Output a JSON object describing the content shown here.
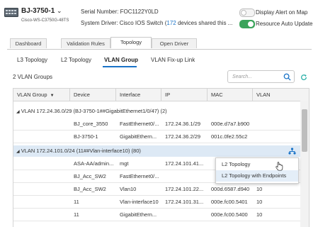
{
  "header": {
    "device_name": "BJ-3750-1",
    "device_model": "Cisco-WS-C3750G-48TS",
    "serial_label": "Serial Number:",
    "serial_value": "FOC1122Y0LD",
    "driver_label": "System Driver:",
    "driver_value": "Cisco IOS Switch (",
    "driver_count": "172",
    "driver_suffix": " devices shared this ...",
    "toggles": [
      {
        "label": "Display Alert on Map",
        "on": false
      },
      {
        "label": "Resource Auto Update",
        "on": true
      }
    ]
  },
  "tabs": [
    "Dashboard",
    "Validation Rules",
    "Topology",
    "Open Driver"
  ],
  "active_tab": "Topology",
  "subtabs": [
    "L3 Topology",
    "L2 Topology",
    "VLAN Group",
    "VLAN Fix-up Link"
  ],
  "active_subtab": "VLAN Group",
  "vlan_count_text": "2 VLAN Groups",
  "search": {
    "placeholder": "Search..."
  },
  "table": {
    "columns": [
      "VLAN Group",
      "Device",
      "Interface",
      "IP",
      "MAC",
      "VLAN"
    ],
    "groups": [
      {
        "label": "VLAN 172.24.36.0/29 (BJ-3750-1##GigabitEthernet1/0/47) (2)"
      },
      {
        "label": "VLAN 172.24.101.0/24 (11##Vlan-interface10) (80)"
      }
    ],
    "rows": [
      [
        "",
        "BJ_core_3550",
        "FastEthernet0/...",
        "172.24.36.1/29",
        "000e.d7a7.b900",
        ""
      ],
      [
        "",
        "BJ-3750-1",
        "GigabitEthern...",
        "172.24.36.2/29",
        "001c.0fe2.55c2",
        ""
      ],
      [
        "",
        "ASA-AA/admin...",
        "mgt",
        "172.24.101.41...",
        "",
        ""
      ],
      [
        "",
        "BJ_Acc_SW2",
        "FastEthernet0/...",
        "",
        "",
        ""
      ],
      [
        "",
        "BJ_Acc_SW2",
        "Vlan10",
        "172.24.101.22...",
        "000d.6587.d940",
        "10"
      ],
      [
        "",
        "11",
        "Vlan-interface10",
        "172.24.101.31...",
        "000e.fc00.5401",
        "10"
      ],
      [
        "",
        "11",
        "GigabitEthern...",
        "",
        "000e.fc00.5400",
        "10"
      ]
    ]
  },
  "context_menu": {
    "items": [
      "L2 Topology",
      "L2 Topology with Endpoints"
    ],
    "hovered": "L2 Topology with Endpoints"
  },
  "colors": {
    "accent": "#1a73c7",
    "toggle_on": "#3aa35a",
    "group_highlight": "#dde9f5"
  }
}
